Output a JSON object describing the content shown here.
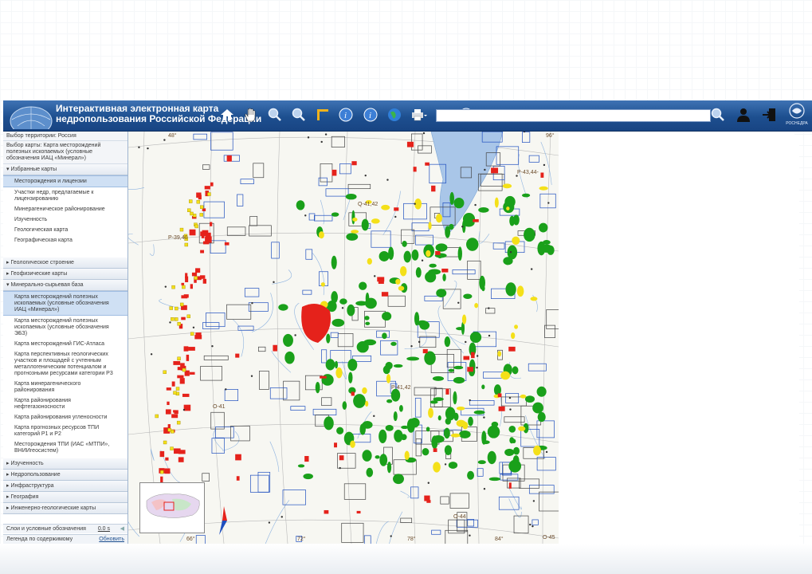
{
  "header": {
    "title_line1": "Интерактивная электронная карта",
    "title_line2": "недропользования Российской Федерации",
    "search_placeholder": "",
    "logo_text": "РОСНЕДРА"
  },
  "toolbar_icons": [
    "home-icon",
    "hand-pan-icon",
    "zoom-in-icon",
    "zoom-out-icon",
    "measure-icon",
    "identify-icon",
    "info-icon",
    "globe-icon",
    "print-icon",
    "settings-icon",
    "help-icon"
  ],
  "sidebar": {
    "territory": "Выбор территории: Россия",
    "map_choice": "Выбор карты: Карта месторождений полезных ископаемых (условные обозначения ИАЦ «Минерал»)",
    "favorites": {
      "label": "▾ Избранные карты",
      "items": [
        "Месторождения и лицензии",
        "Участки недр, предлагаемые к лицензированию",
        "Минерагеническое районирование",
        "Изученность",
        "Геологическая карта",
        "Географическая карта"
      ]
    },
    "geology": "▸ Геологическое строение",
    "geophysics": "▸ Геофизические карты",
    "mineral": {
      "label": "▾ Минерально-сырьевая база",
      "items": [
        "Карта месторождений полезных ископаемых (условные обозначения ИАЦ «Минерал»)",
        "Карта месторождений полезных ископаемых (условные обозначения ЭБЗ)",
        "Карта месторождений ГИС-Атласа",
        "Карта перспективных геологических участков и площадей с учтенным металлогеническим потенциалом и прогнозными ресурсами категории Р3",
        "Карта минерагенического районирования",
        "Карта районирования нефтегазоносности",
        "Карта районирования угленосности",
        "Карта прогнозных ресурсов ТПИ категорий Р1 и Р2",
        "Месторождения ТПИ (ИАС «МТПИ», ВНИИгеосистем)"
      ]
    },
    "collapsed": [
      "▸ Изученность",
      "▸ Недропользование",
      "▸ Инфраструктура",
      "▸ География",
      "▸ Инженерно-геологические карты"
    ],
    "footer_layers": "Слои и условные обозначения",
    "footer_layers_value": "0.0 s",
    "footer_legend": "Легенда по содержимому",
    "footer_refresh": "Обновить"
  },
  "map": {
    "labels": [
      "48°",
      "96°",
      "Р-39,40",
      "Q-41,42",
      "Р-43,44-",
      "О-41",
      "О-44",
      "О-45",
      "66°",
      "72°",
      "78°",
      "84°",
      "Р-41,42"
    ],
    "colors": {
      "green": "#1aa01a",
      "red": "#e5221b",
      "yellow": "#f4e019",
      "blue": "#1f4fbf",
      "water": "#a9c6e8"
    }
  }
}
